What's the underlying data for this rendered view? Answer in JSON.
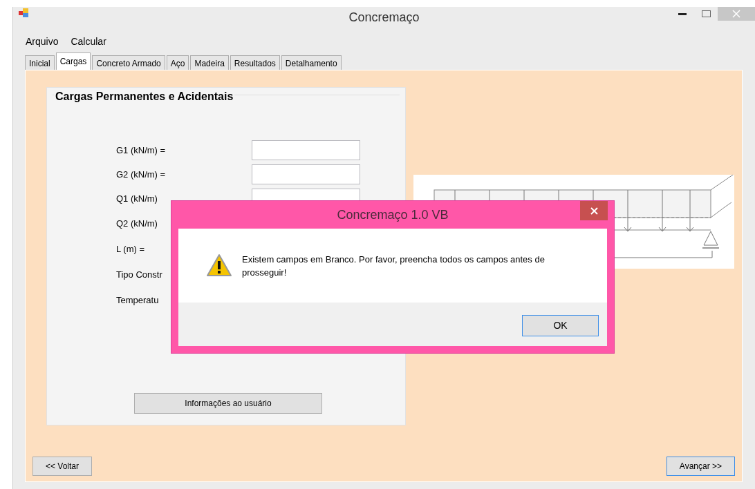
{
  "window": {
    "title": "Concremaço"
  },
  "menu": [
    "Arquivo",
    "Calcular"
  ],
  "tabs": [
    {
      "label": "Inicial",
      "selected": false
    },
    {
      "label": "Cargas",
      "selected": true
    },
    {
      "label": "Concreto Armado",
      "selected": false
    },
    {
      "label": "Aço",
      "selected": false
    },
    {
      "label": "Madeira",
      "selected": false
    },
    {
      "label": "Resultados",
      "selected": false
    },
    {
      "label": "Detalhamento",
      "selected": false
    }
  ],
  "group": {
    "title": "Cargas Permanentes e Acidentais",
    "rows": [
      {
        "kind": "input",
        "label": "G1 (kN/m) ="
      },
      {
        "kind": "input",
        "label": "G2 (kN/m) ="
      },
      {
        "kind": "input",
        "label": "Q1 (kN/m)"
      },
      {
        "kind": "label",
        "label": "Q2 (kN/m)"
      },
      {
        "kind": "label",
        "label": "L (m) ="
      },
      {
        "kind": "label",
        "label": "Tipo Constr"
      },
      {
        "kind": "label",
        "label": "Temperatu"
      }
    ],
    "button": "Informações ao usuário"
  },
  "nav_buttons": [
    {
      "label": "<< Voltar",
      "focused": false
    },
    {
      "label": "Avançar >>",
      "focused": true
    }
  ],
  "dialog": {
    "title": "Concremaço 1.0 VB",
    "message": "Existem campos em Branco. Por favor, preencha todos os campos antes de prosseguir!",
    "button": "OK"
  }
}
